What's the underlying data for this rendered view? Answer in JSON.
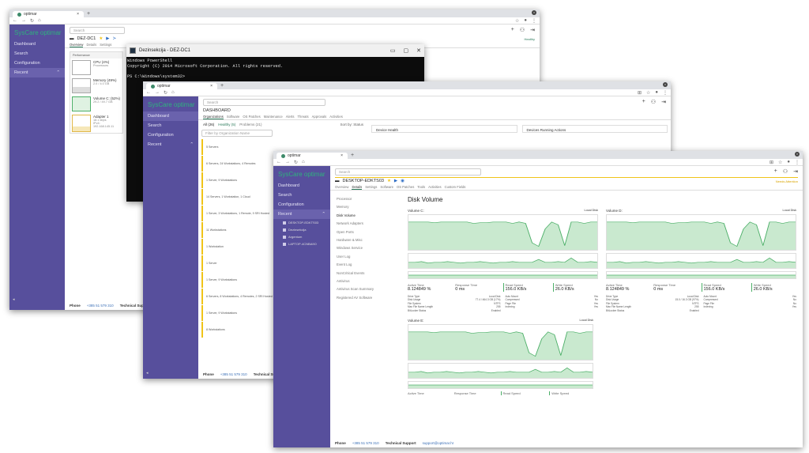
{
  "browser": {
    "tab_title": "optimar",
    "new_tab": "+",
    "close": "×"
  },
  "app": {
    "logo": "SysCare optimar",
    "nav": [
      "Dashboard",
      "Search",
      "Configuration",
      "Recent"
    ],
    "search_placeholder": "Search",
    "footer": {
      "phone_label": "Phone",
      "phone": "+385 51 579 310",
      "support_label": "Technical Support",
      "support_email": "support@optimar.hr"
    }
  },
  "w1": {
    "device": "DEZ-DC1",
    "tabs": [
      "Overview",
      "Details",
      "Settings"
    ],
    "status": "Healthy",
    "performance_label": "Performance",
    "perf_items": [
      {
        "title": "CPU",
        "sub": "Processors",
        "extra": "(4%)"
      },
      {
        "title": "Memory",
        "sub": "2.0 / 4.0 GB",
        "extra": "(49%)"
      },
      {
        "title": "Volume C:",
        "sub": "29.2 / 49.7 GB",
        "extra": "(52%)"
      },
      {
        "title": "Adapter 1",
        "sub": "18.1 kbps",
        "extra": "",
        "sub2": "IPv4:",
        "sub3": "192.168.145.11"
      }
    ]
  },
  "ps": {
    "title": "Dezinsekcija - DEZ-DC1",
    "lines": [
      "Windows PowerShell",
      "Copyright (C) 2014 Microsoft Corporation. All rights reserved.",
      "",
      "PS C:\\Windows\\system32>",
      "",
      "PS C:\\Windows\\system32>"
    ]
  },
  "w2": {
    "heading": "DASHBOARD",
    "tabs": [
      "Organizations",
      "Software",
      "OS Patches",
      "Maintenance",
      "Alerts",
      "Threats",
      "Approvals",
      "Activities"
    ],
    "filters": [
      "All (26)",
      "Healthy (5)",
      "Problems (21)"
    ],
    "sort": "Sort by: Status",
    "filter_placeholder": "Filter by Organization Name",
    "org_rows": [
      "5 Servers",
      "6 Servers, 24 Workstations, 4 Remotes",
      "1 Server, 9 Workstations",
      "14 Servers, 1 Workstation, 1 Cloud",
      "1 Server, 3 Workstations, 1 Remote, 9 SRI Hosted",
      "11 Workstations",
      "1 Workstation",
      "1 Server",
      "1 Server, 9 Workstations",
      "6 Servers, 8 Workstations, 4 Remotes, 2 SRI Hosted",
      "1 Server, 9 Workstations",
      "8 Workstations"
    ],
    "panel1": "Device Health",
    "panel2": "Devices Running Actions"
  },
  "w3": {
    "device": "DESKTOP-EDKTS03",
    "status": "Needs Attention",
    "tabs": [
      "Overview",
      "Details",
      "Settings",
      "Software",
      "OS Patches",
      "Tools",
      "Activities",
      "Custom Fields"
    ],
    "recent_items": [
      "DESKTOP-EDKTS03",
      "Dezinsekcija",
      "Argentum",
      "LAPTOP-4CNBA9O"
    ],
    "side_menu": [
      "Processor",
      "Memory",
      "Disk Volume",
      "Network Adapters",
      "Open Ports",
      "Hardware & Misc",
      "Windows Service",
      "User Log",
      "Event Log",
      "NonCritical Events",
      "Antivirus",
      "Antivirus Scan Summary",
      "Registered AV Software"
    ],
    "title": "Disk Volume",
    "volumes": [
      {
        "name": "Volume C:",
        "local": "Local Disk",
        "active_time_label": "Active Time",
        "active_time": "8.124849 %",
        "response_label": "Response Time",
        "response": "0 ms",
        "read_label": "Read Speed",
        "read": "156.0 KB/s",
        "write_label": "Write Speed",
        "write": "26.0 KB/s",
        "details_left": [
          [
            "Drive Type",
            "Local Disk"
          ],
          [
            "Disk Usage",
            "77.4 / 464.3 GB (17%)"
          ],
          [
            "File System",
            "NTFS"
          ],
          [
            "Max File Name Length",
            "255"
          ],
          [
            "BitLocker Status",
            "Enabled"
          ]
        ],
        "details_right": [
          [
            "Auto Mount",
            "Yes"
          ],
          [
            "Compressed",
            "No"
          ],
          [
            "Page File",
            "Yes"
          ],
          [
            "Indexing",
            "Yes"
          ]
        ]
      },
      {
        "name": "Volume D:",
        "local": "Local Disk",
        "active_time_label": "Active Time",
        "active_time": "8.124849 %",
        "response_label": "Response Time",
        "response": "0 ms",
        "read_label": "Read Speed",
        "read": "156.0 KB/s",
        "write_label": "Write Speed",
        "write": "26.0 KB/s",
        "details_left": [
          [
            "Drive Type",
            "Local Disk"
          ],
          [
            "Disk Usage",
            "15.0 / 16.3 GB (97%)"
          ],
          [
            "File System",
            "NTFS"
          ],
          [
            "Max File Name Length",
            "255"
          ],
          [
            "BitLocker Status",
            "Enabled"
          ]
        ],
        "details_right": [
          [
            "Auto Mount",
            "Yes"
          ],
          [
            "Compressed",
            "No"
          ],
          [
            "Page File",
            "No"
          ],
          [
            "Indexing",
            "Yes"
          ]
        ]
      },
      {
        "name": "Volume E:",
        "local": "Local Disk",
        "active_time_label": "Active Time",
        "response_label": "Response Time",
        "read_label": "Read Speed",
        "write_label": "Write Speed"
      }
    ],
    "colors": {
      "accent": "#2b7a5b",
      "sidebar": "#574f9c",
      "warning": "#f0c419",
      "chart_fill": "#c9e9cf",
      "chart_line": "#4caf68"
    }
  }
}
